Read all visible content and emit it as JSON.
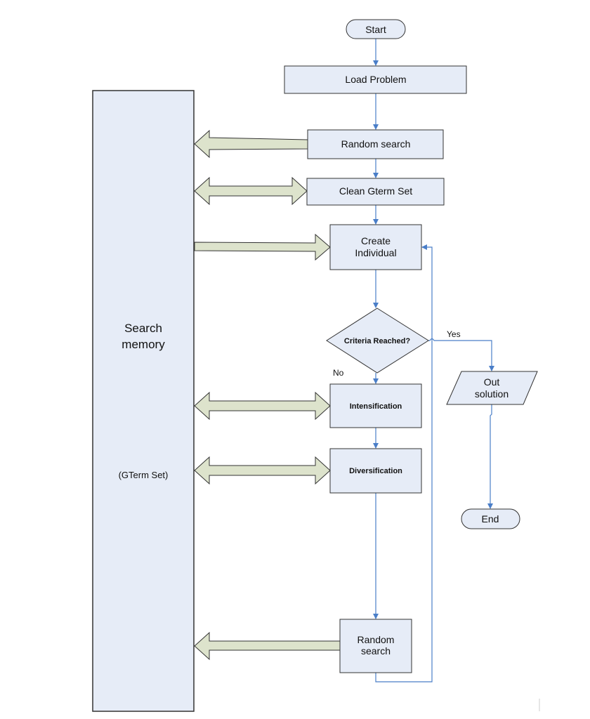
{
  "colors": {
    "node_fill": "#e6ecf7",
    "node_stroke": "#333333",
    "connector": "#4a7ec8",
    "block_arrow_fill": "#dde3cc",
    "block_arrow_stroke": "#333333"
  },
  "memory": {
    "title_line1": "Search",
    "title_line2": "memory",
    "subtitle": "(GTerm Set)"
  },
  "nodes": {
    "start": "Start",
    "load_problem": "Load Problem",
    "random_search_top": "Random search",
    "clean_gterm_set": "Clean Gterm Set",
    "create_individual_line1": "Create",
    "create_individual_line2": "Individual",
    "criteria": "Criteria Reached?",
    "intensification": "Intensification",
    "diversification": "Diversification",
    "random_search_bottom_line1": "Random",
    "random_search_bottom_line2": "search",
    "out_solution_line1": "Out",
    "out_solution_line2": "solution",
    "end": "End"
  },
  "labels": {
    "yes": "Yes",
    "no": "No"
  }
}
